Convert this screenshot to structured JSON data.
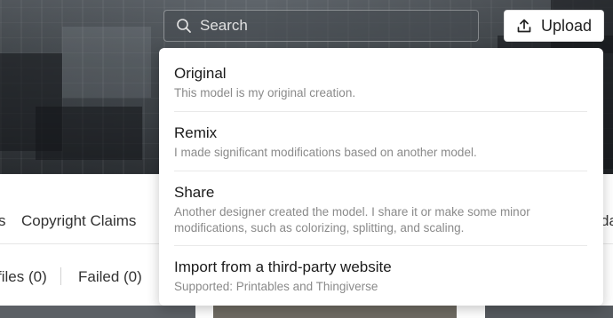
{
  "header": {
    "search": {
      "placeholder": "Search"
    },
    "upload_label": "Upload"
  },
  "tabs": {
    "left_partial": "s",
    "copyright": "Copyright Claims",
    "right_partial": "da"
  },
  "filters": {
    "files": "files (0)",
    "failed": "Failed (0)"
  },
  "upload_menu": {
    "items": [
      {
        "title": "Original",
        "description": "This model is my original creation."
      },
      {
        "title": "Remix",
        "description": "I made significant modifications based on another model."
      },
      {
        "title": "Share",
        "description": "Another designer created the model. I share it or make some minor modifications, such as colorizing, splitting, and scaling."
      },
      {
        "title": "Import from a third-party website",
        "description": "Supported: Printables and Thingiverse"
      }
    ]
  }
}
